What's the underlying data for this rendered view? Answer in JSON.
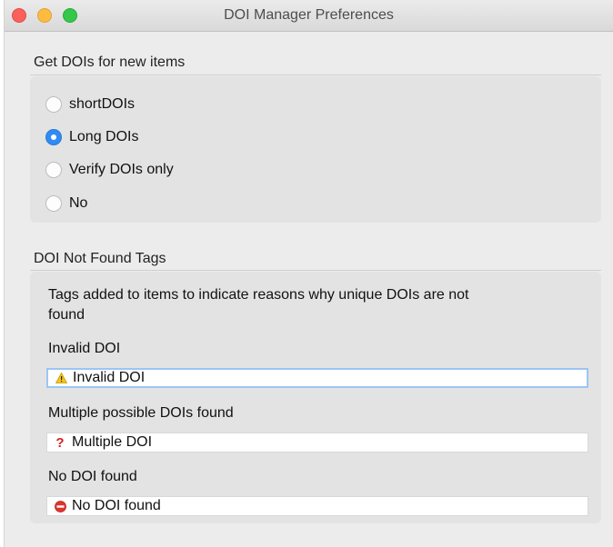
{
  "window": {
    "title": "DOI Manager Preferences"
  },
  "doi_section": {
    "title": "Get DOIs for new items",
    "options": [
      {
        "label": "shortDOIs",
        "selected": false
      },
      {
        "label": "Long DOIs",
        "selected": true
      },
      {
        "label": "Verify DOIs only",
        "selected": false
      },
      {
        "label": "No",
        "selected": false
      }
    ]
  },
  "tags_section": {
    "title": "DOI Not Found Tags",
    "description_line1": "Tags added to items to indicate reasons why unique DOIs are not",
    "description_line2": "found",
    "fields": [
      {
        "label": "Invalid DOI",
        "value": "Invalid DOI",
        "icon": "warning-icon",
        "focused": true
      },
      {
        "label": "Multiple possible DOIs found",
        "value": "Multiple DOI",
        "icon": "question-icon",
        "focused": false
      },
      {
        "label": "No DOI found",
        "value": "No DOI found",
        "icon": "no-entry-icon",
        "focused": false
      }
    ]
  },
  "colors": {
    "accent": "#2f8cf5",
    "focus_ring": "#9cc5f5"
  }
}
